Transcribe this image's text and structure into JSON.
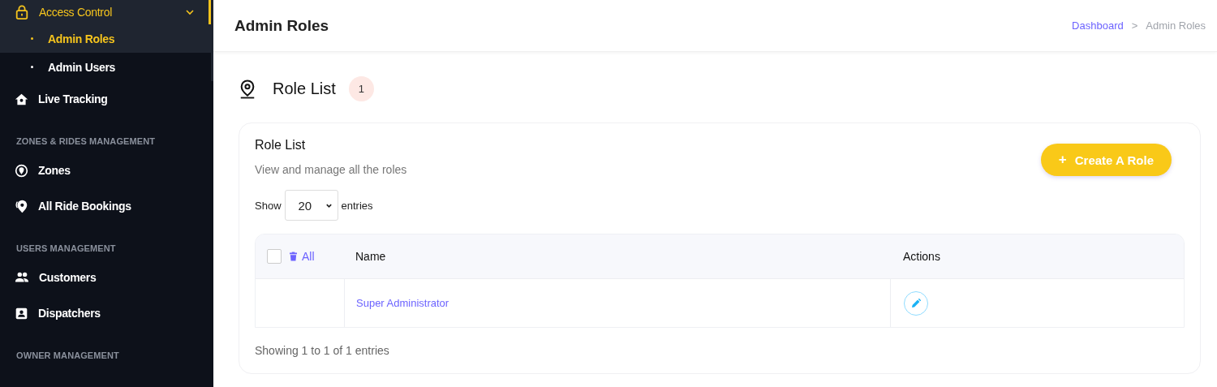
{
  "sidebar": {
    "items": [
      {
        "kind": "group",
        "label": "Access Control",
        "expanded": true,
        "selected": true,
        "children": [
          {
            "label": "Admin Roles",
            "selected": true
          },
          {
            "label": "Admin Users",
            "selected": false
          }
        ]
      },
      {
        "kind": "link",
        "label": "Live Tracking",
        "selected": false
      },
      {
        "kind": "heading",
        "label": "ZONES & RIDES MANAGEMENT"
      },
      {
        "kind": "link",
        "label": "Zones",
        "selected": false
      },
      {
        "kind": "link",
        "label": "All Ride Bookings",
        "selected": false
      },
      {
        "kind": "heading",
        "label": "USERS MANAGEMENT"
      },
      {
        "kind": "link",
        "label": "Customers",
        "selected": false
      },
      {
        "kind": "link",
        "label": "Dispatchers",
        "selected": false
      },
      {
        "kind": "heading",
        "label": "OWNER MANAGEMENT"
      }
    ]
  },
  "header": {
    "title": "Admin Roles",
    "breadcrumb": [
      "Dashboard",
      "Admin Roles"
    ],
    "separator": ">"
  },
  "page_heading": {
    "title": "Role List",
    "badge": "1"
  },
  "card": {
    "title": "Role List",
    "subtitle": "View and manage all the roles",
    "create_button": {
      "icon": "+",
      "label": "Create A Role"
    },
    "length": {
      "before": "Show",
      "value": "20",
      "after": "entries"
    },
    "table": {
      "select_all": {
        "checked": false,
        "label": "All"
      },
      "columns": [
        "Name",
        "Actions"
      ],
      "rows": [
        {
          "name": "Super Administrator"
        }
      ]
    },
    "info": "Showing 1 to 1 of 1 entries"
  }
}
